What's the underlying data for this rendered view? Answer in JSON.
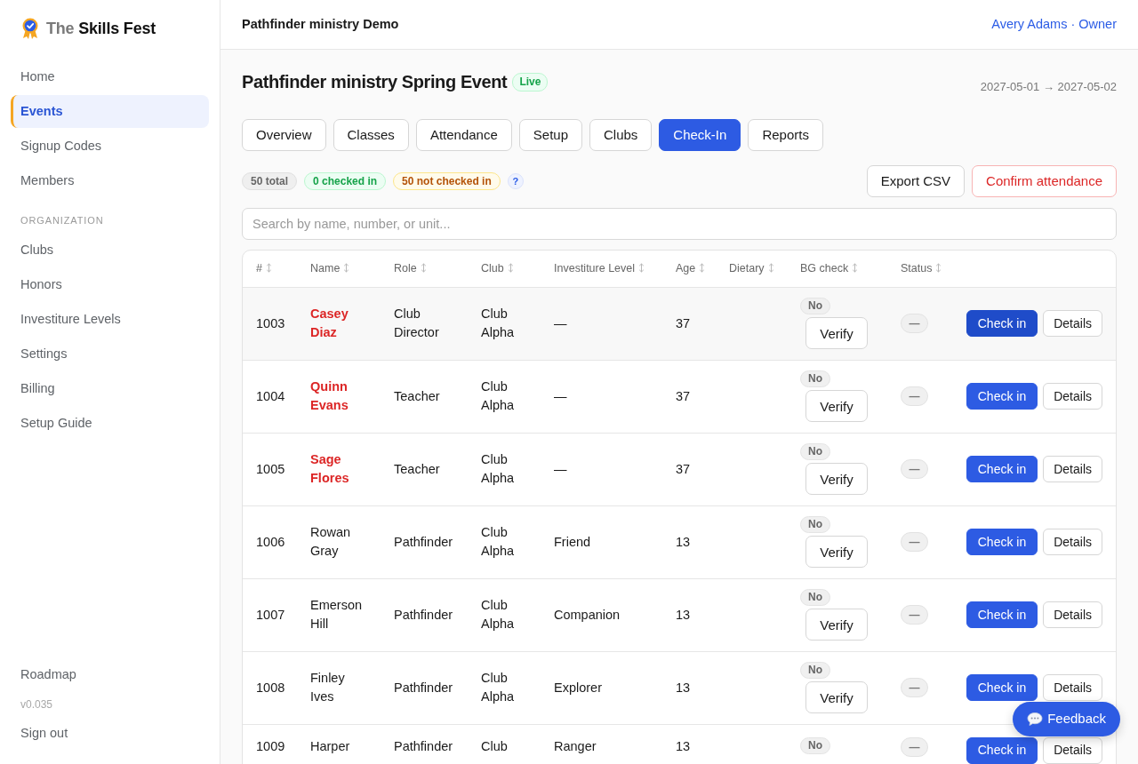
{
  "sidebar": {
    "brand": "The **Skills Fest**",
    "nav": [
      {
        "label": "Home",
        "selected": false
      },
      {
        "label": "Events",
        "selected": true
      },
      {
        "label": "Signup Codes",
        "selected": false
      },
      {
        "label": "Members",
        "selected": false
      }
    ],
    "section_label": "ORGANIZATION",
    "org_nav": [
      {
        "label": "Clubs",
        "selected": false
      },
      {
        "label": "Honors",
        "selected": false
      },
      {
        "label": "Investiture Levels",
        "selected": false
      },
      {
        "label": "Settings",
        "selected": false
      },
      {
        "label": "Billing",
        "selected": false
      },
      {
        "label": "Setup Guide",
        "selected": false
      }
    ],
    "footer": [
      {
        "kind": "link",
        "label": "Roadmap"
      },
      {
        "kind": "version",
        "label": "v0.035"
      },
      {
        "kind": "link",
        "label": "Sign out"
      }
    ]
  },
  "topbar": {
    "workspace": "Pathfinder ministry Demo",
    "user": "Avery Adams · Owner"
  },
  "event": {
    "title": "Pathfinder ministry Spring Event",
    "status_badge": "Live",
    "dates": "2027-05-01 → 2027-05-02"
  },
  "tabs": [
    {
      "label": "Overview",
      "selected": false
    },
    {
      "label": "Classes",
      "selected": false
    },
    {
      "label": "Attendance",
      "selected": false
    },
    {
      "label": "Setup",
      "selected": false
    },
    {
      "label": "Clubs",
      "selected": false
    },
    {
      "label": "Check-In",
      "selected": true
    },
    {
      "label": "Reports",
      "selected": false
    }
  ],
  "counts": [
    {
      "text": "50 total",
      "kind": "neutral"
    },
    {
      "text": "0 checked in",
      "kind": "success"
    },
    {
      "text": "50 not checked in",
      "kind": "warning"
    },
    {
      "text": "?",
      "kind": "info"
    }
  ],
  "actions": [
    {
      "label": "Export CSV",
      "kind": "default"
    },
    {
      "label": "Confirm attendance",
      "kind": "danger"
    }
  ],
  "search": {
    "placeholder": "Search by name, number, or unit..."
  },
  "table": {
    "columns": [
      "#",
      "Name",
      "Role",
      "Club",
      "Investiture Level",
      "Age",
      "Dietary",
      "BG check",
      "Status"
    ],
    "rows": [
      {
        "number": "1003",
        "name": "Casey Diaz",
        "flagged": true,
        "role": "Club Director",
        "club": "Club Alpha",
        "investiture_level": "—",
        "age": "37",
        "bg_check": "No",
        "verify": "Verify",
        "status": "—",
        "check_in": "Check in",
        "details": "Details",
        "hovered": true
      },
      {
        "number": "1004",
        "name": "Quinn Evans",
        "flagged": true,
        "role": "Teacher",
        "club": "Club Alpha",
        "investiture_level": "—",
        "age": "37",
        "bg_check": "No",
        "verify": "Verify",
        "status": "—",
        "check_in": "Check in",
        "details": "Details",
        "hovered": false
      },
      {
        "number": "1005",
        "name": "Sage Flores",
        "flagged": true,
        "role": "Teacher",
        "club": "Club Alpha",
        "investiture_level": "—",
        "age": "37",
        "bg_check": "No",
        "verify": "Verify",
        "status": "—",
        "check_in": "Check in",
        "details": "Details",
        "hovered": false
      },
      {
        "number": "1006",
        "name": "Rowan Gray",
        "flagged": false,
        "role": "Pathfinder",
        "club": "Club Alpha",
        "investiture_level": "Friend",
        "age": "13",
        "bg_check": "No",
        "verify": "Verify",
        "status": "—",
        "check_in": "Check in",
        "details": "Details",
        "hovered": false
      },
      {
        "number": "1007",
        "name": "Emerson Hill",
        "flagged": false,
        "role": "Pathfinder",
        "club": "Club Alpha",
        "investiture_level": "Companion",
        "age": "13",
        "bg_check": "No",
        "verify": "Verify",
        "status": "—",
        "check_in": "Check in",
        "details": "Details",
        "hovered": false
      },
      {
        "number": "1008",
        "name": "Finley Ives",
        "flagged": false,
        "role": "Pathfinder",
        "club": "Club Alpha",
        "investiture_level": "Explorer",
        "age": "13",
        "bg_check": "No",
        "verify": "Verify",
        "status": "—",
        "check_in": "Check in",
        "details": "Details",
        "hovered": false
      },
      {
        "number": "1009",
        "name": "Harper",
        "flagged": false,
        "role": "Pathfinder",
        "club": "Club",
        "investiture_level": "Ranger",
        "age": "13",
        "bg_check": "No",
        "status": "—",
        "check_in": "Check in",
        "details": "Details",
        "hovered": false
      }
    ]
  },
  "feedback": {
    "label": "Feedback"
  }
}
